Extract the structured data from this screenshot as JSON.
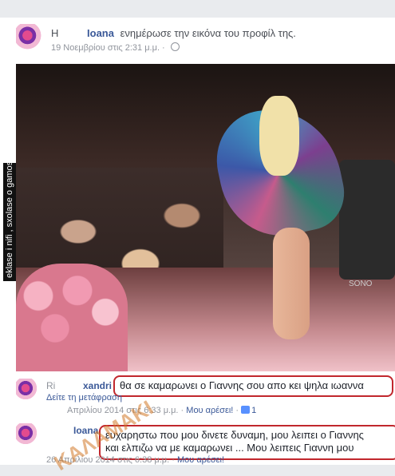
{
  "post": {
    "name_prefix": "H",
    "author": "Ioana",
    "action": "ενημέρωσε την εικόνα του προφίλ της.",
    "date": "19 Νοεμβρίου στις 2:31 μ.μ. ·"
  },
  "photo": {
    "side_watermark": "eklase i nifi , sxolase o gamos",
    "drum_text": "SONO"
  },
  "comments": [
    {
      "author": "xandri",
      "author_prefix": "Ri",
      "text": "θα σε καμαρωνει ο Γιαννης σου απο κει ψηλα  ιωαννα",
      "translation_link": "Δείτε τη μετάφραση",
      "date": "Απριλίου 2014 στις 6:33 μ.μ.",
      "like_label": "Μου αρέσει!",
      "like_count": "1"
    },
    {
      "author": "Ioana",
      "text_line1": "ευχαρηστω που μου δινετε δυναμη, μου λειπει ο Γιαννης",
      "text_line2": "και ελπιζω να με καμαρωνει ... Μου λειπεις Γιαννη μου",
      "date": "26 Απριλίου 2014 στις 6:38 μ.μ.",
      "like_label": "Μου αρέσει!"
    }
  ],
  "watermark": "ΚΑΛΑΜΑΚΙ"
}
